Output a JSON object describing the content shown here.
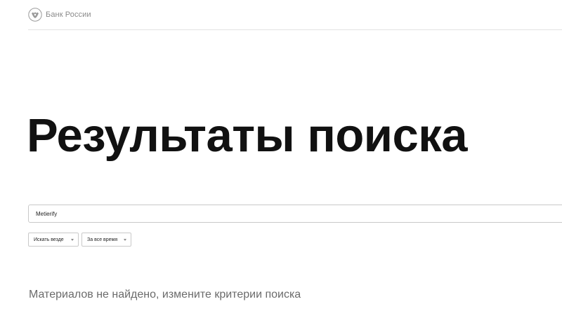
{
  "header": {
    "logo_text": "Банк России",
    "logo_icon": "double-headed-eagle-icon"
  },
  "page_title": "Результаты поиска",
  "search": {
    "value": "Metierify",
    "placeholder": ""
  },
  "filters": {
    "scope_label": "Искать везде",
    "period_label": "За все время"
  },
  "results": {
    "empty_message": "Материалов не найдено, измените критерии поиска"
  },
  "colors": {
    "background": "#ffffff",
    "title": "#111111",
    "muted_text": "#6b6b6b",
    "border": "#c9c9c9"
  }
}
